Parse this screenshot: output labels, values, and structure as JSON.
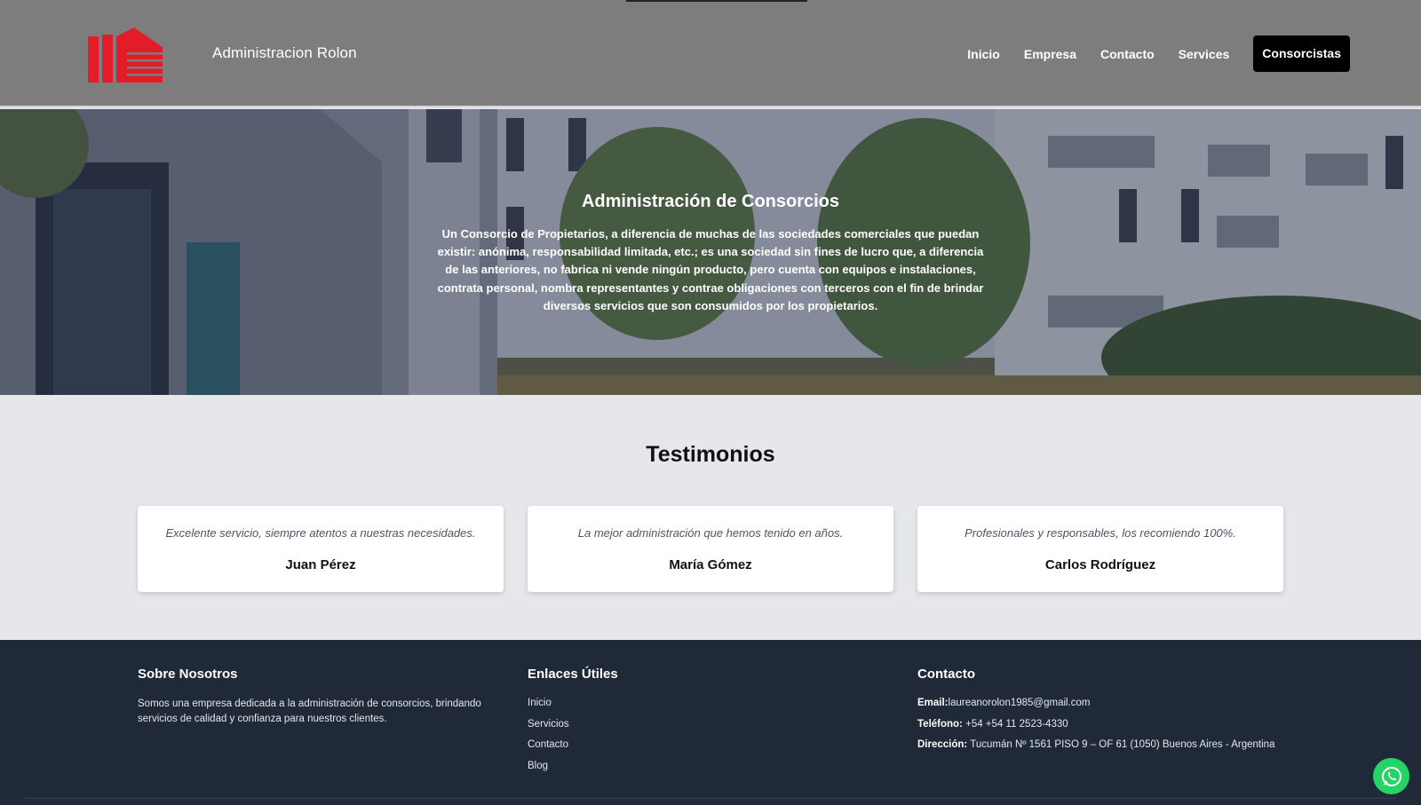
{
  "header": {
    "brand": "Administracion Rolon",
    "nav": [
      "Inicio",
      "Empresa",
      "Contacto",
      "Services"
    ],
    "cta": "Consorcistas"
  },
  "hero": {
    "title": "Administración de Consorcios",
    "text": "Un Consorcio de Propietarios, a diferencia de muchas de las sociedades comerciales que puedan existir: anónima, responsabilidad limitada, etc.; es una sociedad sin fines de lucro que, a diferencia de las anteriores, no fabrica ni vende ningún producto, pero cuenta con equipos e instalaciones, contrata personal, nombra representantes y contrae obligaciones con terceros con el fin de brindar diversos servicios que son consumidos por los propietarios."
  },
  "testimonials": {
    "title": "Testimonios",
    "items": [
      {
        "quote": "Excelente servicio, siempre atentos a nuestras necesidades.",
        "author": "Juan Pérez"
      },
      {
        "quote": "La mejor administración que hemos tenido en años.",
        "author": "María Gómez"
      },
      {
        "quote": "Profesionales y responsables, los recomiendo 100%.",
        "author": "Carlos Rodríguez"
      }
    ]
  },
  "footer": {
    "about": {
      "title": "Sobre Nosotros",
      "text": "Somos una empresa dedicada a la administración de consorcios, brindando servicios de calidad y confianza para nuestros clientes."
    },
    "links": {
      "title": "Enlaces Útiles",
      "items": [
        "Inicio",
        "Servicios",
        "Contacto",
        "Blog"
      ]
    },
    "contact": {
      "title": "Contacto",
      "email_label": "Email:",
      "email": "laureanorolon1985@gmail.com",
      "phone_label": "Teléfono:",
      "phone": "+54 +54 11 2523-4330",
      "address_label": "Dirección:",
      "address": "Tucumán Nº 1561 PISO 9 – OF 61 (1050) Buenos Aires - Argentina"
    }
  },
  "colors": {
    "header_bg": "#7d7d7d",
    "logo_red": "#e11d2a",
    "footer_bg": "#1f2937",
    "whatsapp": "#25d366"
  }
}
